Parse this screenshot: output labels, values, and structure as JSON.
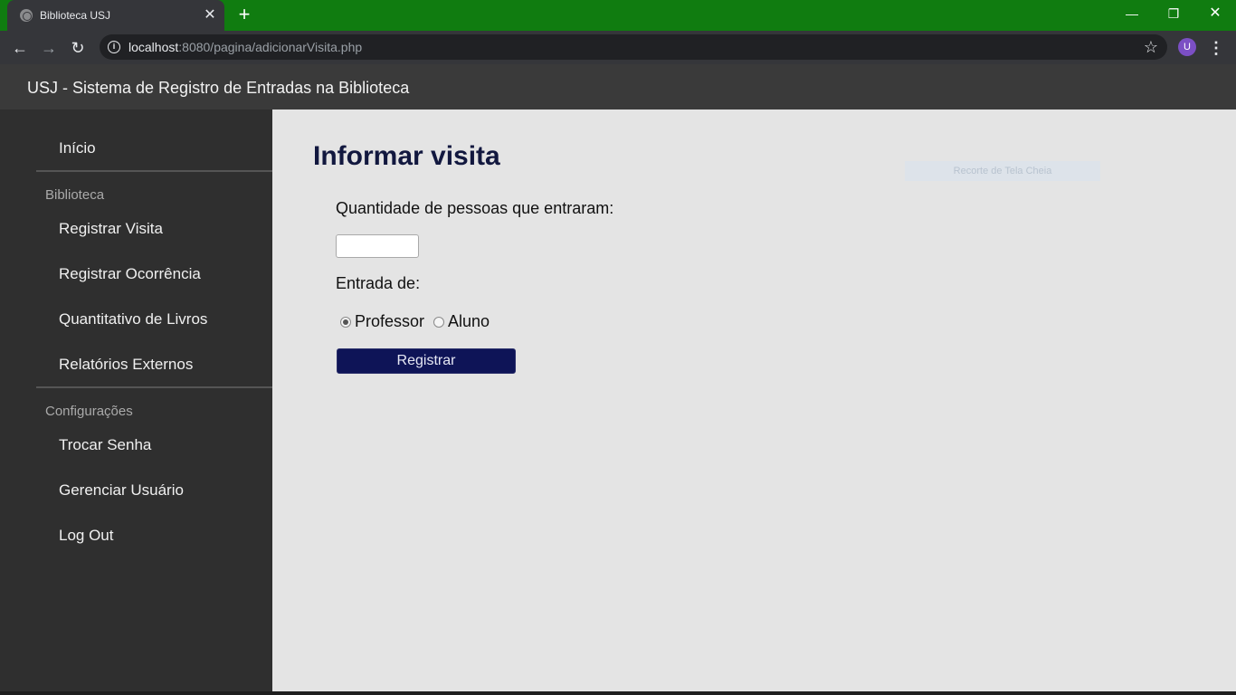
{
  "browser": {
    "tab_title": "Biblioteca USJ",
    "tab_close": "✕",
    "new_tab": "+",
    "url_host": "localhost",
    "url_rest": ":8080/pagina/adicionarVisita.php",
    "profile_initial": "U",
    "frame_color": "#107c10"
  },
  "header": {
    "title": "USJ - Sistema de Registro de Entradas na Biblioteca"
  },
  "sidebar": {
    "home": "Início",
    "section_library": "Biblioteca",
    "library_items": [
      "Registrar Visita",
      "Registrar Ocorrência",
      "Quantitativo de Livros",
      "Relatórios Externos"
    ],
    "section_settings": "Configurações",
    "settings_items": [
      "Trocar Senha",
      "Gerenciar Usuário",
      "Log Out"
    ]
  },
  "main": {
    "title": "Informar visita",
    "overlay_hint": "Recorte de Tela Cheia",
    "quantity_label": "Quantidade de pessoas que entraram:",
    "quantity_value": "",
    "entry_label": "Entrada de:",
    "radio_options": [
      "Professor",
      "Aluno"
    ],
    "selected_option": "Professor",
    "submit_label": "Registrar"
  },
  "colors": {
    "sidebar_bg": "#2f2f2f",
    "header_bg": "#3a3a3a",
    "title_color": "#12183f",
    "button_bg": "#0e1457"
  }
}
